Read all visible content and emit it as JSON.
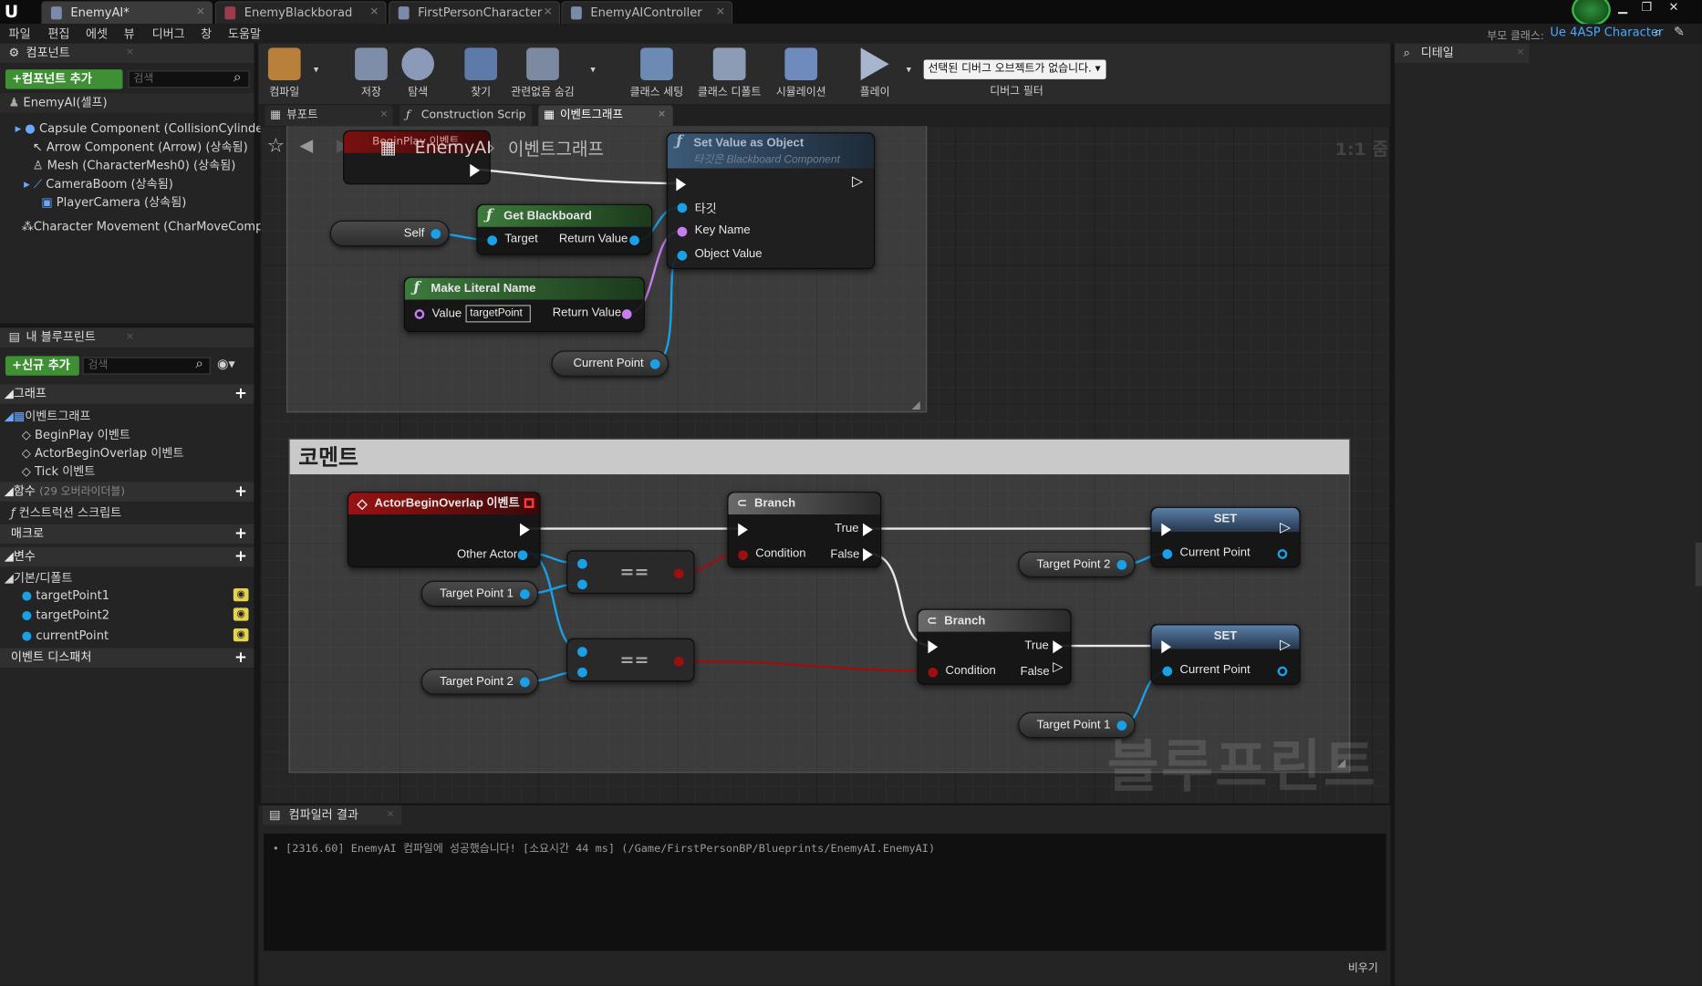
{
  "tabs": [
    {
      "label": "EnemyAI*",
      "active": true
    },
    {
      "label": "EnemyBlackborad",
      "active": false
    },
    {
      "label": "FirstPersonCharacter",
      "active": false
    },
    {
      "label": "EnemyAIController",
      "active": false
    }
  ],
  "menu": [
    "파일",
    "편집",
    "에셋",
    "뷰",
    "디버그",
    "창",
    "도움말"
  ],
  "parent_class": {
    "label": "부모 클래스:",
    "value": "Ue 4ASP Character"
  },
  "components": {
    "title": "컴포넌트",
    "add_button": "+컴포넌트 추가",
    "search_placeholder": "검색",
    "self": "EnemyAI(셀프)",
    "items": [
      "Capsule Component (CollisionCylinder) (상",
      "Arrow Component (Arrow) (상속됨)",
      "Mesh (CharacterMesh0) (상속됨)",
      "CameraBoom (상속됨)",
      "PlayerCamera (상속됨)",
      "Character Movement (CharMoveComp) (상"
    ]
  },
  "my_blueprint": {
    "title": "내 블루프린트",
    "add_button": "+신규 추가",
    "search_placeholder": "검색",
    "graph_label": "그래프",
    "event_graph_label": "이벤트그래프",
    "events": [
      "BeginPlay 이벤트",
      "ActorBeginOverlap 이벤트",
      "Tick 이벤트"
    ],
    "functions_label": "함수",
    "functions_count": "(29 오버라이더블)",
    "construction_script": "컨스트럭션 스크립트",
    "macros_label": "매크로",
    "variables_label": "변수",
    "default_category": "기본/디폴트",
    "variables": [
      "targetPoint1",
      "targetPoint2",
      "currentPoint"
    ],
    "dispatchers_label": "이벤트 디스패처"
  },
  "toolbar": {
    "compile": "컴파일",
    "save": "저장",
    "browse": "탐색",
    "find": "찾기",
    "hide_unrelated": "관련없음 숨김",
    "class_settings": "클래스 세팅",
    "class_defaults": "클래스 디폴트",
    "simulation": "시뮬레이션",
    "play": "플레이",
    "debug_select": "선택된 디버그 오브젝트가 없습니다.",
    "debug_filter": "디버그 필터"
  },
  "doc_tabs": [
    "뷰포트",
    "Construction Scrip",
    "이벤트그래프"
  ],
  "breadcrumb": {
    "root": "EnemyAI",
    "current": "이벤트그래프",
    "zoom": "1:1 줌"
  },
  "graph": {
    "beginplay_label": "BeginPlay 이벤트",
    "set_value_node": {
      "title": "Set Value as Object",
      "subtitle": "타깃은 Blackboard Component",
      "pins": [
        "타깃",
        "Key Name",
        "Object Value"
      ]
    },
    "get_blackboard_node": {
      "title": "Get Blackboard",
      "in": "Target",
      "out": "Return Value"
    },
    "make_literal_node": {
      "title": "Make Literal Name",
      "in": "Value",
      "value": "targetPoint",
      "out": "Return Value"
    },
    "self_node": "Self",
    "current_point_node": "Current Point",
    "comment_title": "코멘트",
    "overlap_node": {
      "title": "ActorBeginOverlap 이벤트",
      "out": "Other Actor"
    },
    "target1_a": "Target Point 1",
    "target2_a": "Target Point 2",
    "target2_b": "Target Point 2",
    "target1_b": "Target Point 1",
    "eq_label": "==",
    "branch1": {
      "title": "Branch",
      "condition": "Condition",
      "true_label": "True",
      "false_label": "False"
    },
    "branch2": {
      "title": "Branch",
      "condition": "Condition",
      "true_label": "True",
      "false_label": "False"
    },
    "set1": {
      "title": "SET",
      "pin": "Current Point"
    },
    "set2": {
      "title": "SET",
      "pin": "Current Point"
    },
    "watermark": "블루프린트"
  },
  "details": {
    "title": "디테일"
  },
  "compiler": {
    "title": "컴파일러 결과",
    "log": "[2316.60] EnemyAI 컴파일에 성공했습니다! [소요시간 44 ms] (/Game/FirstPersonBP/Blueprints/EnemyAI.EnemyAI)",
    "clear": "비우기"
  },
  "colors": {
    "accent_green": "#3f8f34",
    "object_pin": "#1aa0e6",
    "bool_pin": "#9b0f0f",
    "name_pin": "#c77df0"
  }
}
